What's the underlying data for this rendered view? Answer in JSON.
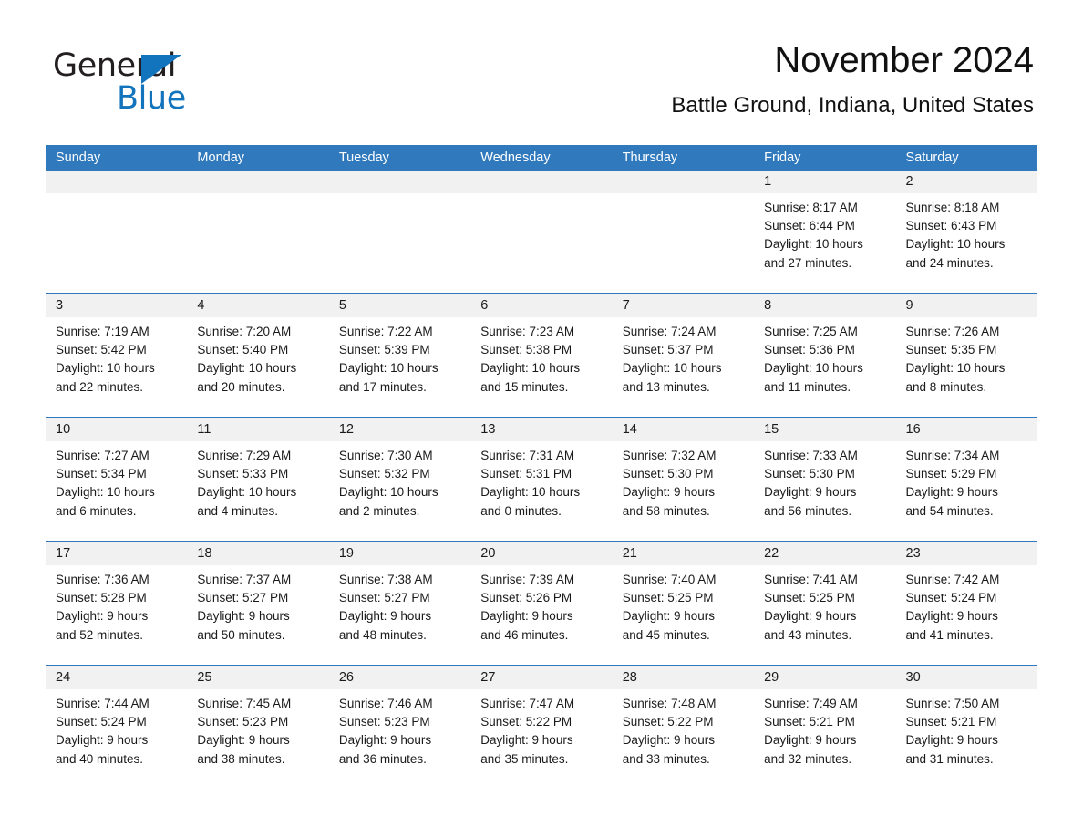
{
  "brand": {
    "name_part1": "General",
    "name_part2": "Blue",
    "triangle_icon": "triangle-icon",
    "accent_color": "#1274bc"
  },
  "header": {
    "title": "November 2024",
    "subtitle": "Battle Ground, Indiana, United States"
  },
  "theme": {
    "header_blue": "#3079bd",
    "day_number_band": "#f1f1f1",
    "text": "#1a1a1a"
  },
  "weekdays": [
    "Sunday",
    "Monday",
    "Tuesday",
    "Wednesday",
    "Thursday",
    "Friday",
    "Saturday"
  ],
  "weeks": [
    [
      {
        "day": "",
        "empty": true
      },
      {
        "day": "",
        "empty": true
      },
      {
        "day": "",
        "empty": true
      },
      {
        "day": "",
        "empty": true
      },
      {
        "day": "",
        "empty": true
      },
      {
        "day": "1",
        "sunrise": "Sunrise: 8:17 AM",
        "sunset": "Sunset: 6:44 PM",
        "daylight_1": "Daylight: 10 hours",
        "daylight_2": "and 27 minutes."
      },
      {
        "day": "2",
        "sunrise": "Sunrise: 8:18 AM",
        "sunset": "Sunset: 6:43 PM",
        "daylight_1": "Daylight: 10 hours",
        "daylight_2": "and 24 minutes."
      }
    ],
    [
      {
        "day": "3",
        "sunrise": "Sunrise: 7:19 AM",
        "sunset": "Sunset: 5:42 PM",
        "daylight_1": "Daylight: 10 hours",
        "daylight_2": "and 22 minutes."
      },
      {
        "day": "4",
        "sunrise": "Sunrise: 7:20 AM",
        "sunset": "Sunset: 5:40 PM",
        "daylight_1": "Daylight: 10 hours",
        "daylight_2": "and 20 minutes."
      },
      {
        "day": "5",
        "sunrise": "Sunrise: 7:22 AM",
        "sunset": "Sunset: 5:39 PM",
        "daylight_1": "Daylight: 10 hours",
        "daylight_2": "and 17 minutes."
      },
      {
        "day": "6",
        "sunrise": "Sunrise: 7:23 AM",
        "sunset": "Sunset: 5:38 PM",
        "daylight_1": "Daylight: 10 hours",
        "daylight_2": "and 15 minutes."
      },
      {
        "day": "7",
        "sunrise": "Sunrise: 7:24 AM",
        "sunset": "Sunset: 5:37 PM",
        "daylight_1": "Daylight: 10 hours",
        "daylight_2": "and 13 minutes."
      },
      {
        "day": "8",
        "sunrise": "Sunrise: 7:25 AM",
        "sunset": "Sunset: 5:36 PM",
        "daylight_1": "Daylight: 10 hours",
        "daylight_2": "and 11 minutes."
      },
      {
        "day": "9",
        "sunrise": "Sunrise: 7:26 AM",
        "sunset": "Sunset: 5:35 PM",
        "daylight_1": "Daylight: 10 hours",
        "daylight_2": "and 8 minutes."
      }
    ],
    [
      {
        "day": "10",
        "sunrise": "Sunrise: 7:27 AM",
        "sunset": "Sunset: 5:34 PM",
        "daylight_1": "Daylight: 10 hours",
        "daylight_2": "and 6 minutes."
      },
      {
        "day": "11",
        "sunrise": "Sunrise: 7:29 AM",
        "sunset": "Sunset: 5:33 PM",
        "daylight_1": "Daylight: 10 hours",
        "daylight_2": "and 4 minutes."
      },
      {
        "day": "12",
        "sunrise": "Sunrise: 7:30 AM",
        "sunset": "Sunset: 5:32 PM",
        "daylight_1": "Daylight: 10 hours",
        "daylight_2": "and 2 minutes."
      },
      {
        "day": "13",
        "sunrise": "Sunrise: 7:31 AM",
        "sunset": "Sunset: 5:31 PM",
        "daylight_1": "Daylight: 10 hours",
        "daylight_2": "and 0 minutes."
      },
      {
        "day": "14",
        "sunrise": "Sunrise: 7:32 AM",
        "sunset": "Sunset: 5:30 PM",
        "daylight_1": "Daylight: 9 hours",
        "daylight_2": "and 58 minutes."
      },
      {
        "day": "15",
        "sunrise": "Sunrise: 7:33 AM",
        "sunset": "Sunset: 5:30 PM",
        "daylight_1": "Daylight: 9 hours",
        "daylight_2": "and 56 minutes."
      },
      {
        "day": "16",
        "sunrise": "Sunrise: 7:34 AM",
        "sunset": "Sunset: 5:29 PM",
        "daylight_1": "Daylight: 9 hours",
        "daylight_2": "and 54 minutes."
      }
    ],
    [
      {
        "day": "17",
        "sunrise": "Sunrise: 7:36 AM",
        "sunset": "Sunset: 5:28 PM",
        "daylight_1": "Daylight: 9 hours",
        "daylight_2": "and 52 minutes."
      },
      {
        "day": "18",
        "sunrise": "Sunrise: 7:37 AM",
        "sunset": "Sunset: 5:27 PM",
        "daylight_1": "Daylight: 9 hours",
        "daylight_2": "and 50 minutes."
      },
      {
        "day": "19",
        "sunrise": "Sunrise: 7:38 AM",
        "sunset": "Sunset: 5:27 PM",
        "daylight_1": "Daylight: 9 hours",
        "daylight_2": "and 48 minutes."
      },
      {
        "day": "20",
        "sunrise": "Sunrise: 7:39 AM",
        "sunset": "Sunset: 5:26 PM",
        "daylight_1": "Daylight: 9 hours",
        "daylight_2": "and 46 minutes."
      },
      {
        "day": "21",
        "sunrise": "Sunrise: 7:40 AM",
        "sunset": "Sunset: 5:25 PM",
        "daylight_1": "Daylight: 9 hours",
        "daylight_2": "and 45 minutes."
      },
      {
        "day": "22",
        "sunrise": "Sunrise: 7:41 AM",
        "sunset": "Sunset: 5:25 PM",
        "daylight_1": "Daylight: 9 hours",
        "daylight_2": "and 43 minutes."
      },
      {
        "day": "23",
        "sunrise": "Sunrise: 7:42 AM",
        "sunset": "Sunset: 5:24 PM",
        "daylight_1": "Daylight: 9 hours",
        "daylight_2": "and 41 minutes."
      }
    ],
    [
      {
        "day": "24",
        "sunrise": "Sunrise: 7:44 AM",
        "sunset": "Sunset: 5:24 PM",
        "daylight_1": "Daylight: 9 hours",
        "daylight_2": "and 40 minutes."
      },
      {
        "day": "25",
        "sunrise": "Sunrise: 7:45 AM",
        "sunset": "Sunset: 5:23 PM",
        "daylight_1": "Daylight: 9 hours",
        "daylight_2": "and 38 minutes."
      },
      {
        "day": "26",
        "sunrise": "Sunrise: 7:46 AM",
        "sunset": "Sunset: 5:23 PM",
        "daylight_1": "Daylight: 9 hours",
        "daylight_2": "and 36 minutes."
      },
      {
        "day": "27",
        "sunrise": "Sunrise: 7:47 AM",
        "sunset": "Sunset: 5:22 PM",
        "daylight_1": "Daylight: 9 hours",
        "daylight_2": "and 35 minutes."
      },
      {
        "day": "28",
        "sunrise": "Sunrise: 7:48 AM",
        "sunset": "Sunset: 5:22 PM",
        "daylight_1": "Daylight: 9 hours",
        "daylight_2": "and 33 minutes."
      },
      {
        "day": "29",
        "sunrise": "Sunrise: 7:49 AM",
        "sunset": "Sunset: 5:21 PM",
        "daylight_1": "Daylight: 9 hours",
        "daylight_2": "and 32 minutes."
      },
      {
        "day": "30",
        "sunrise": "Sunrise: 7:50 AM",
        "sunset": "Sunset: 5:21 PM",
        "daylight_1": "Daylight: 9 hours",
        "daylight_2": "and 31 minutes."
      }
    ]
  ]
}
